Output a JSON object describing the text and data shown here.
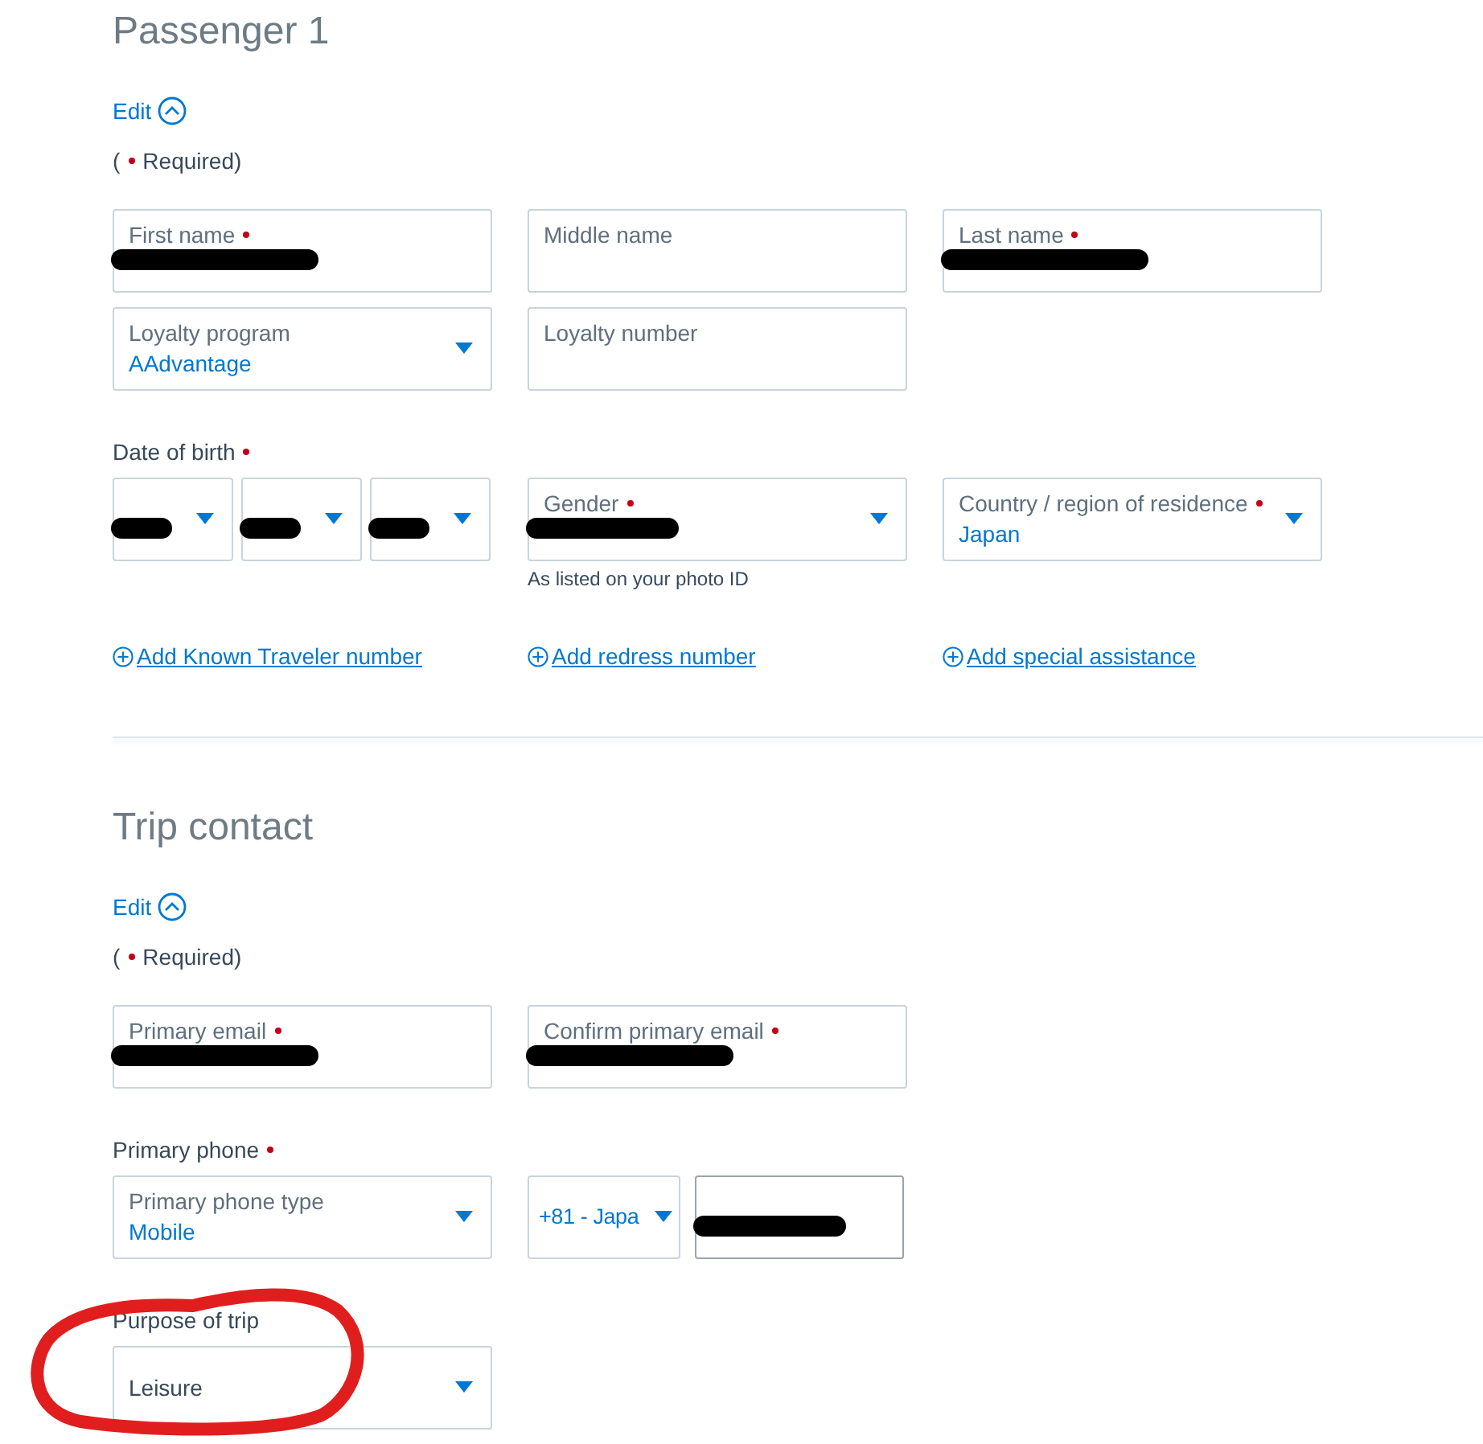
{
  "sections": [
    {
      "title": "Passenger 1",
      "edit": {
        "label": "Edit",
        "expanded": true
      },
      "required_note": {
        "open": "(",
        "text": "Required)"
      },
      "rows": [
        {
          "fields": [
            {
              "kind": "text",
              "label": "First name",
              "required": true,
              "redacted": true
            },
            {
              "kind": "text",
              "label": "Middle name"
            },
            {
              "kind": "text",
              "label": "Last name",
              "required": true,
              "redacted": true
            }
          ]
        },
        {
          "fields": [
            {
              "kind": "select",
              "label": "Loyalty program",
              "value": "AAdvantage"
            },
            {
              "kind": "text",
              "label": "Loyalty number"
            }
          ]
        },
        {
          "label": "Date of birth",
          "required": true,
          "fields": [
            {
              "kind": "date",
              "parts": [
                {
                  "redacted": true
                },
                {
                  "redacted": true
                },
                {
                  "redacted": true
                }
              ]
            },
            {
              "kind": "select",
              "label": "Gender",
              "required": true,
              "redacted": true,
              "hint": "As listed on your photo ID"
            },
            {
              "kind": "select",
              "label": "Country / region of residence",
              "required": true,
              "value": "Japan"
            }
          ]
        }
      ],
      "links": [
        "Add Known Traveler number",
        "Add redress number",
        "Add special assistance"
      ]
    },
    {
      "title": "Trip contact",
      "edit": {
        "label": "Edit",
        "expanded": true
      },
      "required_note": {
        "open": "(",
        "text": "Required)"
      },
      "rows": [
        {
          "fields": [
            {
              "kind": "text",
              "label": "Primary email",
              "required": true,
              "redacted": true
            },
            {
              "kind": "text",
              "label": "Confirm primary email",
              "required": true,
              "redacted": true
            }
          ]
        },
        {
          "label": "Primary phone",
          "required": true,
          "fields": [
            {
              "kind": "select",
              "label": "Primary phone type",
              "value": "Mobile"
            },
            {
              "kind": "code",
              "value": "+81 - Japa"
            },
            {
              "kind": "phone",
              "redacted": true
            }
          ]
        },
        {
          "label": "Purpose of trip",
          "fields": [
            {
              "kind": "plain-select",
              "value": "Leisure"
            }
          ]
        }
      ]
    }
  ]
}
